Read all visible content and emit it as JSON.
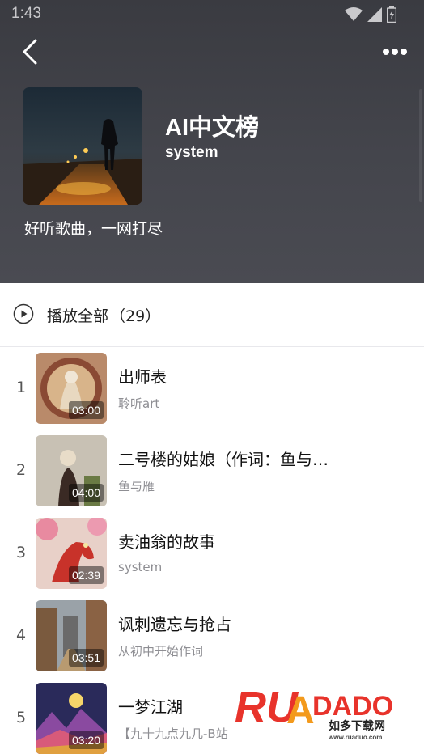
{
  "status_bar": {
    "time": "1:43",
    "icons": [
      "wifi-icon",
      "signal-icon",
      "battery-icon"
    ]
  },
  "header": {
    "back_icon": "chevron-left-icon",
    "more_icon": "more-horizontal-icon",
    "title": "AI中文榜",
    "author": "system",
    "description": "好听歌曲，一网打尽"
  },
  "play_all": {
    "label": "播放全部",
    "count": "（29）",
    "icon": "play-circle-icon"
  },
  "songs": [
    {
      "index": "1",
      "title": "出师表",
      "artist": "聆听art",
      "duration": "03:00"
    },
    {
      "index": "2",
      "title": "二号楼的姑娘（作词：鱼与…",
      "artist": "鱼与雁",
      "duration": "04:00"
    },
    {
      "index": "3",
      "title": "卖油翁的故事",
      "artist": "system",
      "duration": "02:39"
    },
    {
      "index": "4",
      "title": "讽刺遗忘与抢占",
      "artist": "从初中开始作词",
      "duration": "03:51"
    },
    {
      "index": "5",
      "title": "一梦江湖",
      "artist": "【九十九点九几-B站",
      "duration": "03:20"
    }
  ],
  "watermark": {
    "logo_text": "RUANDADO",
    "site_name": "如多下载网",
    "url": "www.ruaduo.com"
  },
  "colors": {
    "header_bg": "#3f4047",
    "accent_orange": "#f39a1c",
    "watermark_red": "#e8332b"
  }
}
